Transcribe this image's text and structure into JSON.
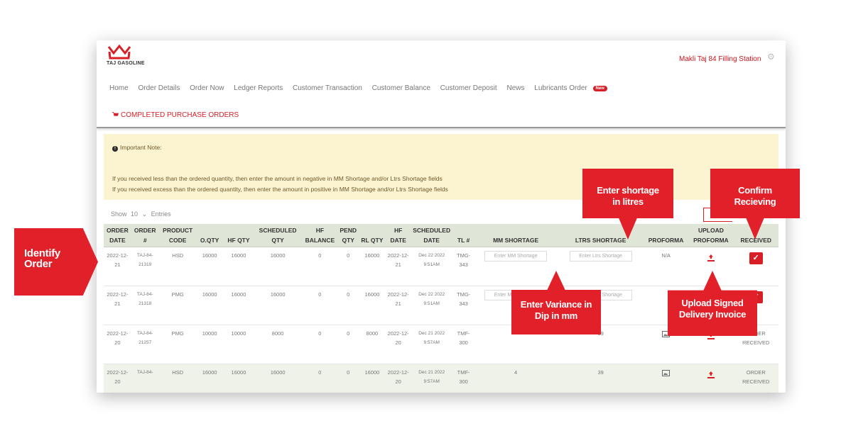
{
  "header": {
    "brand": "TAJ GASOLINE",
    "station": "Makli Taj 84 Filling Station"
  },
  "nav": {
    "items": [
      "Home",
      "Order Details",
      "Order Now",
      "Ledger Reports",
      "Customer Transaction",
      "Customer Balance",
      "Customer Deposit",
      "News",
      "Lubricants Order"
    ],
    "new_badge": "New"
  },
  "breadcrumb": "COMPLETED PURCHASE ORDERS",
  "note": {
    "title": "Important Note:",
    "line1": "If you received less than the ordered quantity, then enter the amount in negative in MM Shortage and/or Ltrs Shortage fields",
    "line2": "If you received excess than the ordered quantity, then enter the amount in positive in MM Shortage and/or Ltrs Shortage fields"
  },
  "show": {
    "prefix": "Show",
    "value": "10",
    "suffix": "Entries"
  },
  "table": {
    "headers": [
      "ORDER DATE",
      "ORDER #",
      "PRODUCT CODE",
      "O.QTY",
      "HF QTY",
      "SCHEDULED QTY",
      "HF BALANCE",
      "PEND QTY",
      "RL QTY",
      "HF DATE",
      "SCHEDULED DATE",
      "TL #",
      "MM SHORTAGE",
      "LTRS SHORTAGE",
      "PROFORMA",
      "UPLOAD PROFORMA",
      "RECEIVED"
    ],
    "mm_placeholder": "Enter MM Shortage",
    "ltrs_placeholder": "Enter Ltrs Shortage",
    "rows": [
      {
        "date": "2022-12-21",
        "order": "TAJ-84-21319",
        "product": "HSD",
        "oqty": "16000",
        "hfqty": "16000",
        "sched": "16000",
        "hfbal": "0",
        "pend": "0",
        "rl": "16000",
        "hfdate": "2022-12-21",
        "scheddate": "Dec 22 2022 9:51AM",
        "tl": "TMG-343",
        "mm": "",
        "ltrs": "",
        "proforma": "N/A",
        "received": ""
      },
      {
        "date": "2022-12-21",
        "order": "TAJ-84-21318",
        "product": "PMG",
        "oqty": "16000",
        "hfqty": "16000",
        "sched": "16000",
        "hfbal": "0",
        "pend": "0",
        "rl": "16000",
        "hfdate": "2022-12-21",
        "scheddate": "Dec 22 2022 9:51AM",
        "tl": "TMG-343",
        "mm": "",
        "ltrs": "",
        "proforma": "",
        "received": ""
      },
      {
        "date": "2022-12-20",
        "order": "TAJ-84-21257",
        "product": "PMG",
        "oqty": "10000",
        "hfqty": "10000",
        "sched": "8000",
        "hfbal": "0",
        "pend": "0",
        "rl": "8000",
        "hfdate": "2022-12-20",
        "scheddate": "Dec 21 2022 9:57AM",
        "tl": "TMF-300",
        "mm": "",
        "ltrs": "19",
        "proforma": "",
        "received": "ORDER RECEIVED"
      },
      {
        "date": "2022-12-20",
        "order": "TAJ-84-",
        "product": "HSD",
        "oqty": "16000",
        "hfqty": "16000",
        "sched": "16000",
        "hfbal": "0",
        "pend": "0",
        "rl": "16000",
        "hfdate": "2022-12-20",
        "scheddate": "Dec 21 2022 9:57AM",
        "tl": "TMF-300",
        "mm": "4",
        "ltrs": "39",
        "proforma": "",
        "received": "ORDER RECEIVED"
      }
    ]
  },
  "annotations": {
    "identify": "Identify Order",
    "shortage_litres": "Enter shortage in litres",
    "confirm": "Confirm Recieving",
    "variance": "Enter Variance in Dip in mm",
    "upload_signed": "Upload Signed Delivery Invoice"
  },
  "colors": {
    "accent": "#d91f26",
    "callout": "#e2202a",
    "note_bg": "#fcf3d0",
    "header_bg": "#dfe6d7"
  }
}
